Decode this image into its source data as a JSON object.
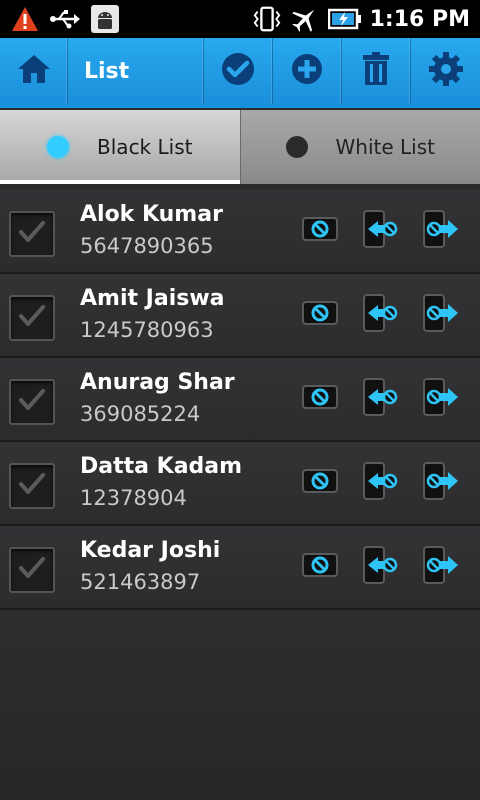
{
  "status_bar": {
    "time": "1:16 PM",
    "icons": [
      "warning-icon",
      "usb-icon",
      "android-icon",
      "vibrate-icon",
      "airplane-icon",
      "battery-charging-icon"
    ]
  },
  "action_bar": {
    "title": "List",
    "buttons": [
      "home-icon",
      "check-icon",
      "add-icon",
      "trash-icon",
      "settings-icon"
    ]
  },
  "tabs": [
    {
      "label": "Black List",
      "active": true,
      "dot_color": "#33ccff"
    },
    {
      "label": "White List",
      "active": false,
      "dot_color": "#222222"
    }
  ],
  "contacts": [
    {
      "name": "Alok Kumar",
      "number": "5647890365",
      "checked": true
    },
    {
      "name": "Amit Jaiswa",
      "number": "1245780963",
      "checked": true
    },
    {
      "name": "Anurag Shar",
      "number": "369085224",
      "checked": true
    },
    {
      "name": "Datta Kadam",
      "number": "12378904",
      "checked": true
    },
    {
      "name": "Kedar Joshi",
      "number": "521463897",
      "checked": true
    }
  ],
  "colors": {
    "accent": "#1f9be6",
    "active_dot": "#33ccff"
  }
}
